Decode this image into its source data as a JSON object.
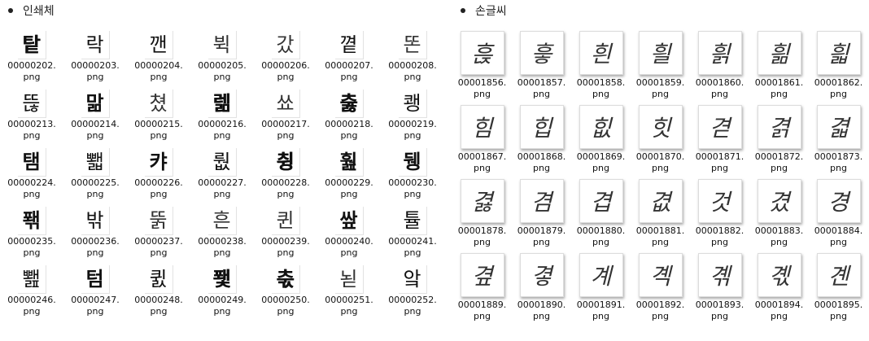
{
  "printed": {
    "heading": "인쇄체",
    "items": [
      {
        "glyph": "탙",
        "weight": "heavy",
        "file": "00000202.",
        "ext": "png"
      },
      {
        "glyph": "락",
        "weight": "normal",
        "file": "00000203.",
        "ext": "png"
      },
      {
        "glyph": "깬",
        "weight": "normal",
        "file": "00000204.",
        "ext": "png"
      },
      {
        "glyph": "뷕",
        "weight": "light",
        "file": "00000205.",
        "ext": "png"
      },
      {
        "glyph": "갔",
        "weight": "light",
        "file": "00000206.",
        "ext": "png"
      },
      {
        "glyph": "꼍",
        "weight": "normal",
        "file": "00000207.",
        "ext": "png"
      },
      {
        "glyph": "똔",
        "weight": "light",
        "file": "00000208.",
        "ext": "png"
      },
      {
        "glyph": "뜮",
        "weight": "normal",
        "file": "00000213.",
        "ext": "png"
      },
      {
        "glyph": "맒",
        "weight": "bold",
        "file": "00000214.",
        "ext": "png"
      },
      {
        "glyph": "쳤",
        "weight": "light",
        "file": "00000215.",
        "ext": "png"
      },
      {
        "glyph": "렒",
        "weight": "heavy",
        "file": "00000216.",
        "ext": "png"
      },
      {
        "glyph": "쑈",
        "weight": "light",
        "file": "00000217.",
        "ext": "png"
      },
      {
        "glyph": "춣",
        "weight": "heavy",
        "file": "00000218.",
        "ext": "png"
      },
      {
        "glyph": "쾡",
        "weight": "small",
        "file": "00000219.",
        "ext": "png"
      },
      {
        "glyph": "탬",
        "weight": "bold",
        "file": "00000224.",
        "ext": "png"
      },
      {
        "glyph": "뾃",
        "weight": "small",
        "file": "00000225.",
        "ext": "png"
      },
      {
        "glyph": "캬",
        "weight": "bold",
        "file": "00000226.",
        "ext": "png"
      },
      {
        "glyph": "뤖",
        "weight": "small",
        "file": "00000227.",
        "ext": "png"
      },
      {
        "glyph": "췽",
        "weight": "heavy",
        "file": "00000228.",
        "ext": "png"
      },
      {
        "glyph": "훮",
        "weight": "bold",
        "file": "00000229.",
        "ext": "png"
      },
      {
        "glyph": "뒝",
        "weight": "bold",
        "file": "00000230.",
        "ext": "png"
      },
      {
        "glyph": "퐦",
        "weight": "bold",
        "file": "00000235.",
        "ext": "png"
      },
      {
        "glyph": "밖",
        "weight": "normal",
        "file": "00000236.",
        "ext": "png"
      },
      {
        "glyph": "뚥",
        "weight": "light",
        "file": "00000237.",
        "ext": "png"
      },
      {
        "glyph": "흔",
        "weight": "light",
        "file": "00000238.",
        "ext": "png"
      },
      {
        "glyph": "퀸",
        "weight": "light",
        "file": "00000239.",
        "ext": "png"
      },
      {
        "glyph": "쌒",
        "weight": "bold",
        "file": "00000240.",
        "ext": "png"
      },
      {
        "glyph": "튤",
        "weight": "normal",
        "file": "00000241.",
        "ext": "png"
      },
      {
        "glyph": "뾆",
        "weight": "small",
        "file": "00000246.",
        "ext": "png"
      },
      {
        "glyph": "텀",
        "weight": "bold",
        "file": "00000247.",
        "ext": "png"
      },
      {
        "glyph": "큀",
        "weight": "small",
        "file": "00000248.",
        "ext": "png"
      },
      {
        "glyph": "퐻",
        "weight": "heavy",
        "file": "00000249.",
        "ext": "png"
      },
      {
        "glyph": "춗",
        "weight": "heavy",
        "file": "00000250.",
        "ext": "png"
      },
      {
        "glyph": "뇓",
        "weight": "light",
        "file": "00000251.",
        "ext": "png"
      },
      {
        "glyph": "앜",
        "weight": "small",
        "file": "00000252.",
        "ext": "png"
      }
    ]
  },
  "handwritten": {
    "heading": "손글씨",
    "items": [
      {
        "glyph": "흕",
        "file": "00001856.",
        "ext": "png"
      },
      {
        "glyph": "흫",
        "file": "00001857.",
        "ext": "png"
      },
      {
        "glyph": "흰",
        "file": "00001858.",
        "ext": "png"
      },
      {
        "glyph": "흴",
        "file": "00001859.",
        "ext": "png"
      },
      {
        "glyph": "흵",
        "file": "00001860.",
        "ext": "png"
      },
      {
        "glyph": "흶",
        "file": "00001861.",
        "ext": "png"
      },
      {
        "glyph": "흷",
        "file": "00001862.",
        "ext": "png"
      },
      {
        "glyph": "힘",
        "file": "00001867.",
        "ext": "png"
      },
      {
        "glyph": "힙",
        "file": "00001868.",
        "ext": "png"
      },
      {
        "glyph": "힚",
        "file": "00001869.",
        "ext": "png"
      },
      {
        "glyph": "힛",
        "file": "00001870.",
        "ext": "png"
      },
      {
        "glyph": "겯",
        "file": "00001871.",
        "ext": "png"
      },
      {
        "glyph": "겱",
        "file": "00001872.",
        "ext": "png"
      },
      {
        "glyph": "겳",
        "file": "00001873.",
        "ext": "png"
      },
      {
        "glyph": "겷",
        "file": "00001878.",
        "ext": "png"
      },
      {
        "glyph": "겸",
        "file": "00001879.",
        "ext": "png"
      },
      {
        "glyph": "겹",
        "file": "00001880.",
        "ext": "png"
      },
      {
        "glyph": "겺",
        "file": "00001881.",
        "ext": "png"
      },
      {
        "glyph": "것",
        "file": "00001882.",
        "ext": "png"
      },
      {
        "glyph": "겼",
        "file": "00001883.",
        "ext": "png"
      },
      {
        "glyph": "경",
        "file": "00001884.",
        "ext": "png"
      },
      {
        "glyph": "곂",
        "file": "00001889.",
        "ext": "png"
      },
      {
        "glyph": "곃",
        "file": "00001890.",
        "ext": "png"
      },
      {
        "glyph": "계",
        "file": "00001891.",
        "ext": "png"
      },
      {
        "glyph": "곅",
        "file": "00001892.",
        "ext": "png"
      },
      {
        "glyph": "곆",
        "file": "00001893.",
        "ext": "png"
      },
      {
        "glyph": "곇",
        "file": "00001894.",
        "ext": "png"
      },
      {
        "glyph": "곈",
        "file": "00001895.",
        "ext": "png"
      }
    ]
  }
}
